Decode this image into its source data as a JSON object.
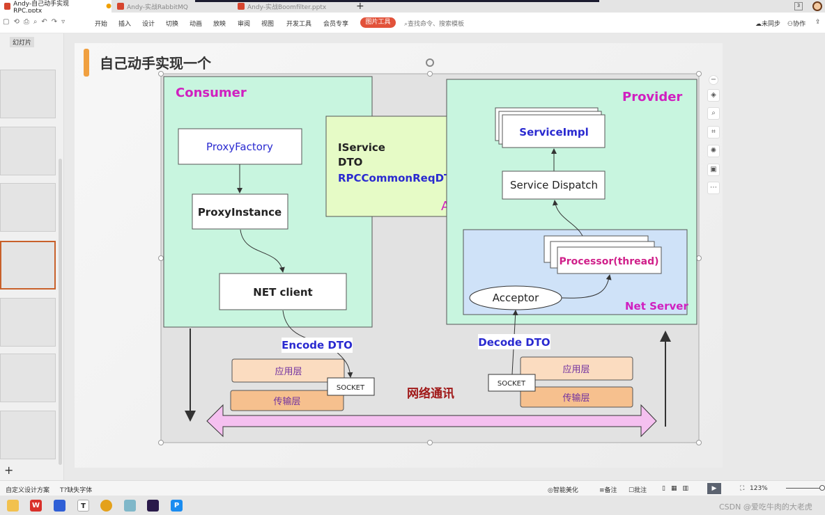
{
  "tabs": [
    {
      "label": "Andy-自己动手实现RPC.pptx",
      "active": true
    },
    {
      "label": "Andy-实战RabbitMQ"
    },
    {
      "label": "Andy-实战Boomfilter.pptx"
    }
  ],
  "new_tab": "+",
  "menu": [
    "开始",
    "插入",
    "设计",
    "切换",
    "动画",
    "放映",
    "审阅",
    "视图",
    "开发工具",
    "会员专享"
  ],
  "picture_tools": "图片工具",
  "search_placeholder": "查找命令、搜索模板",
  "sync": "未同步",
  "collab": "协作",
  "panel_label": "幻灯片",
  "add_slide": "+",
  "slide": {
    "title": "自己动手实现一个",
    "consumer": "Consumer",
    "provider": "Provider",
    "proxy_factory": "ProxyFactory",
    "proxy_instance": "ProxyInstance",
    "net_client": "NET client",
    "api_lines": [
      "IService",
      "DTO",
      "RPCCommonReqDTO"
    ],
    "api": "API",
    "service_impl": "ServiceImpl",
    "service_dispatch": "Service Dispatch",
    "processor": "Processor(thread)",
    "acceptor": "Acceptor",
    "net_server": "Net Server",
    "encode": "Encode DTO",
    "decode": "Decode DTO",
    "app_layer": "应用层",
    "transport_layer": "传输层",
    "socket": "SOCKET",
    "network": "网络通讯",
    "colors": {
      "consumer_fill": "#c8f5df",
      "api_fill": "#e6fbc6",
      "netserver_fill": "#cfe2f8",
      "title_accent": "#f0a040",
      "magenta": "#d020c0",
      "blue": "#2a2ad0",
      "network": "#a01818",
      "arrow_fill": "#f5c0f0"
    }
  },
  "status": {
    "design": "自定义设计方案",
    "missing_font": "缺失字体",
    "smart": "智能美化",
    "notes": "备注",
    "comment": "批注",
    "zoom": "123%"
  },
  "watermark": "CSDN @爱吃牛肉的大老虎"
}
